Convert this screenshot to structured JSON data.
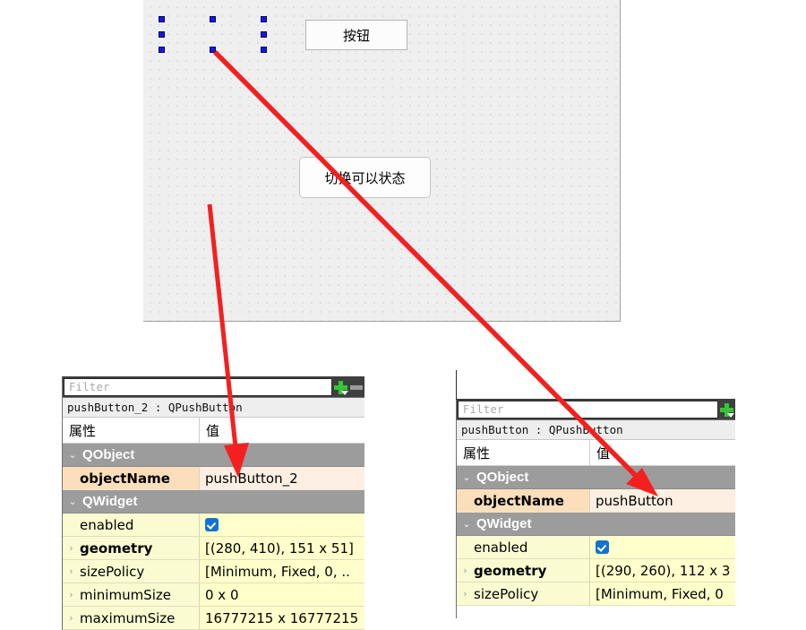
{
  "canvas": {
    "name": "qt-designer-form-canvas",
    "widgets": [
      {
        "id": "pushButton_2",
        "label": "按钮",
        "selected": true
      },
      {
        "id": "pushButton",
        "label": "切换可以状态",
        "selected": false
      }
    ]
  },
  "annotations": {
    "arrow_color": "#f42020",
    "arrows": [
      {
        "name": "arrow-to-pushbutton-2-objectname",
        "from_label": "按钮",
        "to_label": "objectName pushButton_2"
      },
      {
        "name": "arrow-to-pushbutton-objectname",
        "from_label": "切换可以状态",
        "to_label": "objectName pushButton"
      }
    ]
  },
  "panel_left": {
    "name": "property-editor-pushbutton-2",
    "filter": {
      "placeholder": "Filter",
      "value": ""
    },
    "buttons": {
      "add": "add-property-button",
      "remove": "remove-property-button"
    },
    "object_title": "pushButton_2 : QPushButton",
    "header": {
      "name": "属性",
      "value": "值"
    },
    "rows": [
      {
        "kind": "group",
        "expander": "⌄",
        "name": "QObject",
        "value": ""
      },
      {
        "kind": "orange",
        "expander": "",
        "name": "objectName",
        "bold": true,
        "value": "pushButton_2"
      },
      {
        "kind": "group",
        "expander": "⌄",
        "name": "QWidget",
        "value": ""
      },
      {
        "kind": "yellow",
        "expander": "",
        "name": "enabled",
        "bold": false,
        "value": "",
        "checkbox": true
      },
      {
        "kind": "yellow",
        "expander": "›",
        "name": "geometry",
        "bold": true,
        "value": "[(280, 410), 151 x 51]"
      },
      {
        "kind": "yellow",
        "expander": "›",
        "name": "sizePolicy",
        "bold": false,
        "value": "[Minimum, Fixed, 0, .."
      },
      {
        "kind": "yellow",
        "expander": "›",
        "name": "minimumSize",
        "bold": false,
        "value": "0 x 0"
      },
      {
        "kind": "yellow",
        "expander": "›",
        "name": "maximumSize",
        "bold": false,
        "value": "16777215 x 16777215"
      }
    ]
  },
  "panel_right": {
    "name": "property-editor-pushbutton",
    "filter": {
      "placeholder": "Filter",
      "value": ""
    },
    "buttons": {
      "add": "add-property-button",
      "remove": "remove-property-button"
    },
    "object_title": "pushButton : QPushButton",
    "header": {
      "name": "属性",
      "value": "值"
    },
    "rows": [
      {
        "kind": "group",
        "expander": "⌄",
        "name": "QObject",
        "value": ""
      },
      {
        "kind": "orange",
        "expander": "",
        "name": "objectName",
        "bold": true,
        "value": "pushButton"
      },
      {
        "kind": "group",
        "expander": "⌄",
        "name": "QWidget",
        "value": ""
      },
      {
        "kind": "yellow",
        "expander": "",
        "name": "enabled",
        "bold": false,
        "value": "",
        "checkbox": true
      },
      {
        "kind": "yellow",
        "expander": "›",
        "name": "geometry",
        "bold": true,
        "value": "[(290, 260), 112 x 3"
      },
      {
        "kind": "yellow",
        "expander": "›",
        "name": "sizePolicy",
        "bold": false,
        "value": "[Minimum, Fixed, 0"
      }
    ]
  }
}
